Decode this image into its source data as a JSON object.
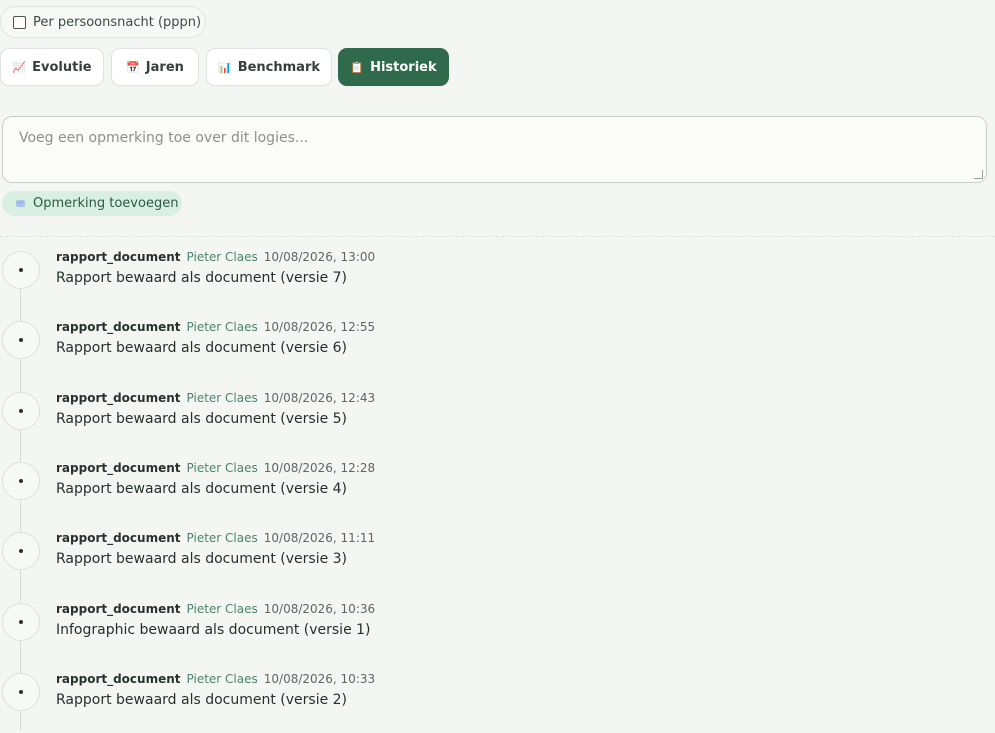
{
  "options": {
    "pppn_label": "Per persoonsnacht (pppn)"
  },
  "tabs": [
    {
      "label": "Evolutie",
      "icon": "📈"
    },
    {
      "label": "Jaren",
      "icon": "📅"
    },
    {
      "label": "Benchmark",
      "icon": "📊"
    },
    {
      "label": "Historiek",
      "icon": "📋"
    }
  ],
  "comment": {
    "placeholder": "Voeg een opmerking toe over dit logies...",
    "add_label": "Opmerking toevoegen"
  },
  "history": [
    {
      "type": "rapport_document",
      "user": "Pieter Claes",
      "time": "10/08/2026, 13:00",
      "message": "Rapport bewaard als document (versie 7)"
    },
    {
      "type": "rapport_document",
      "user": "Pieter Claes",
      "time": "10/08/2026, 12:55",
      "message": "Rapport bewaard als document (versie 6)"
    },
    {
      "type": "rapport_document",
      "user": "Pieter Claes",
      "time": "10/08/2026, 12:43",
      "message": "Rapport bewaard als document (versie 5)"
    },
    {
      "type": "rapport_document",
      "user": "Pieter Claes",
      "time": "10/08/2026, 12:28",
      "message": "Rapport bewaard als document (versie 4)"
    },
    {
      "type": "rapport_document",
      "user": "Pieter Claes",
      "time": "10/08/2026, 11:11",
      "message": "Rapport bewaard als document (versie 3)"
    },
    {
      "type": "rapport_document",
      "user": "Pieter Claes",
      "time": "10/08/2026, 10:36",
      "message": "Infographic bewaard als document (versie 1)"
    },
    {
      "type": "rapport_document",
      "user": "Pieter Claes",
      "time": "10/08/2026, 10:33",
      "message": "Rapport bewaard als document (versie 2)"
    }
  ]
}
